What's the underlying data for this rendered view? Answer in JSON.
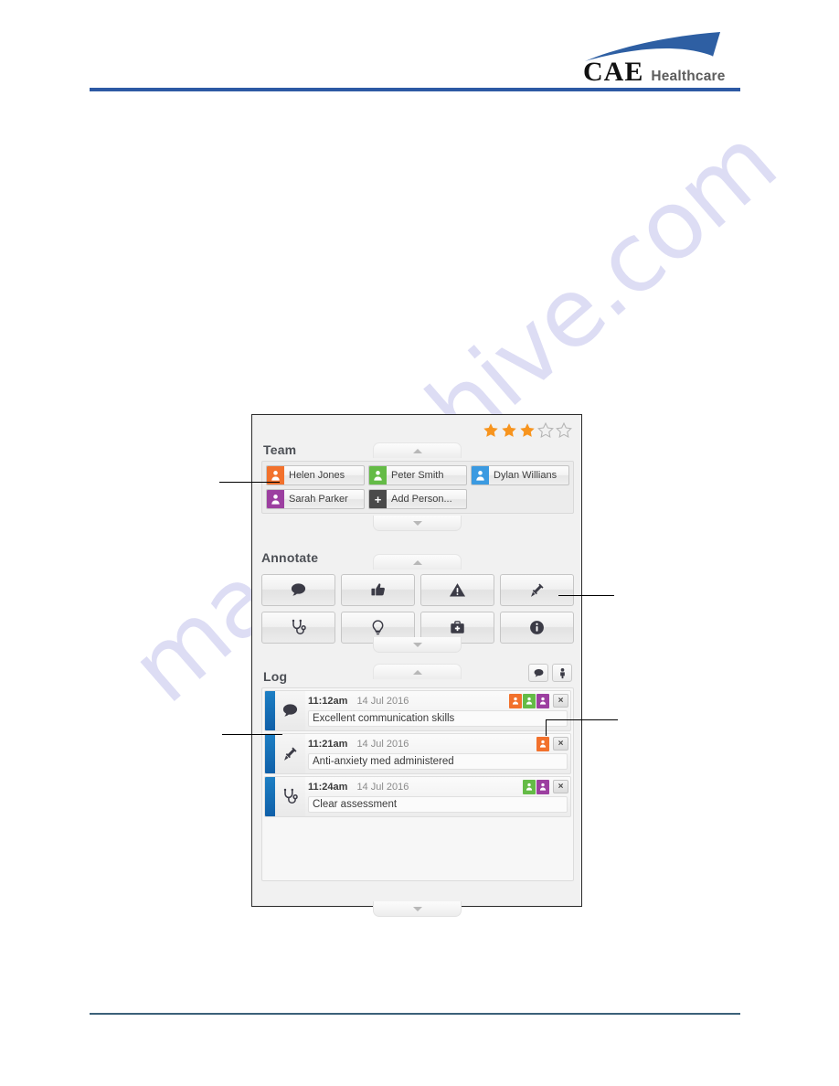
{
  "header": {
    "brand_primary": "CAE",
    "brand_secondary": "Healthcare",
    "rule_color": "#2d59a4"
  },
  "watermark": {
    "text": "manualshive.com",
    "color": "#c9c9ee"
  },
  "panel": {
    "team": {
      "title": "Team",
      "rating": {
        "filled": 3,
        "total": 5,
        "filled_color": "#f7941e",
        "empty_color": "#bbbbbb"
      },
      "members": [
        {
          "name": "Helen Jones",
          "badge_color": "#f2712c",
          "icon": "person-icon"
        },
        {
          "name": "Peter Smith",
          "badge_color": "#64bb46",
          "icon": "person-icon"
        },
        {
          "name": "Dylan Willians",
          "badge_color": "#3b9ae1",
          "icon": "person-icon"
        },
        {
          "name": "Sarah Parker",
          "badge_color": "#9c3fa0",
          "icon": "person-icon"
        }
      ],
      "add_person_label": "Add Person...",
      "add_person_badge_color": "#4a4a4a",
      "add_person_icon": "plus-icon"
    },
    "annotate": {
      "title": "Annotate",
      "buttons": [
        {
          "icon": "speech-bubble-icon",
          "label": "Comment"
        },
        {
          "icon": "thumbs-up-icon",
          "label": "Positive"
        },
        {
          "icon": "warning-triangle-icon",
          "label": "Warning"
        },
        {
          "icon": "syringe-icon",
          "label": "Medication"
        },
        {
          "icon": "stethoscope-icon",
          "label": "Assessment"
        },
        {
          "icon": "lightbulb-icon",
          "label": "Idea"
        },
        {
          "icon": "medical-kit-icon",
          "label": "Equipment"
        },
        {
          "icon": "info-icon",
          "label": "Information"
        }
      ]
    },
    "log": {
      "title": "Log",
      "filters": [
        {
          "icon": "speech-bubble-icon",
          "label": "Annotations filter"
        },
        {
          "icon": "person-icon",
          "label": "People filter"
        }
      ],
      "entries": [
        {
          "time": "11:12am",
          "date": "14 Jul 2016",
          "icon": "speech-bubble-icon",
          "text": "Excellent communication skills",
          "tags": [
            "#f2712c",
            "#64bb46",
            "#9c3fa0"
          ],
          "delete_label": "×"
        },
        {
          "time": "11:21am",
          "date": "14 Jul 2016",
          "icon": "syringe-icon",
          "text": "Anti-anxiety med administered",
          "tags": [
            "#f2712c"
          ],
          "delete_label": "×"
        },
        {
          "time": "11:24am",
          "date": "14 Jul 2016",
          "icon": "stethoscope-icon",
          "text": "Clear assessment",
          "tags": [
            "#64bb46",
            "#9c3fa0"
          ],
          "delete_label": "×"
        }
      ]
    }
  }
}
